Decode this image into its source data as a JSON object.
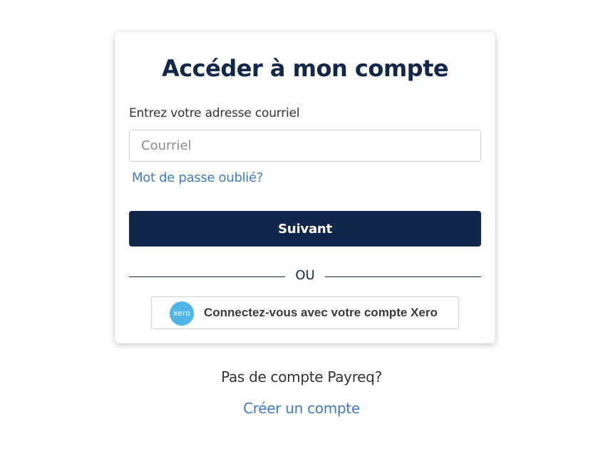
{
  "login": {
    "title": "Accéder à mon compte",
    "email_label": "Entrez votre adresse courriel",
    "email_value": "",
    "email_placeholder": "Courriel",
    "forgot_password": "Mot de passe oublié?",
    "next_button": "Suivant",
    "or_separator": "OU",
    "xero_button": "Connectez-vous avec votre compte Xero",
    "xero_logo_text": "xero"
  },
  "footer": {
    "no_account": "Pas de compte Payreq?",
    "create_account": "Créer un compte"
  },
  "colors": {
    "primary": "#12284b",
    "link": "#3f7cc2",
    "xero": "#4fb5e6"
  }
}
